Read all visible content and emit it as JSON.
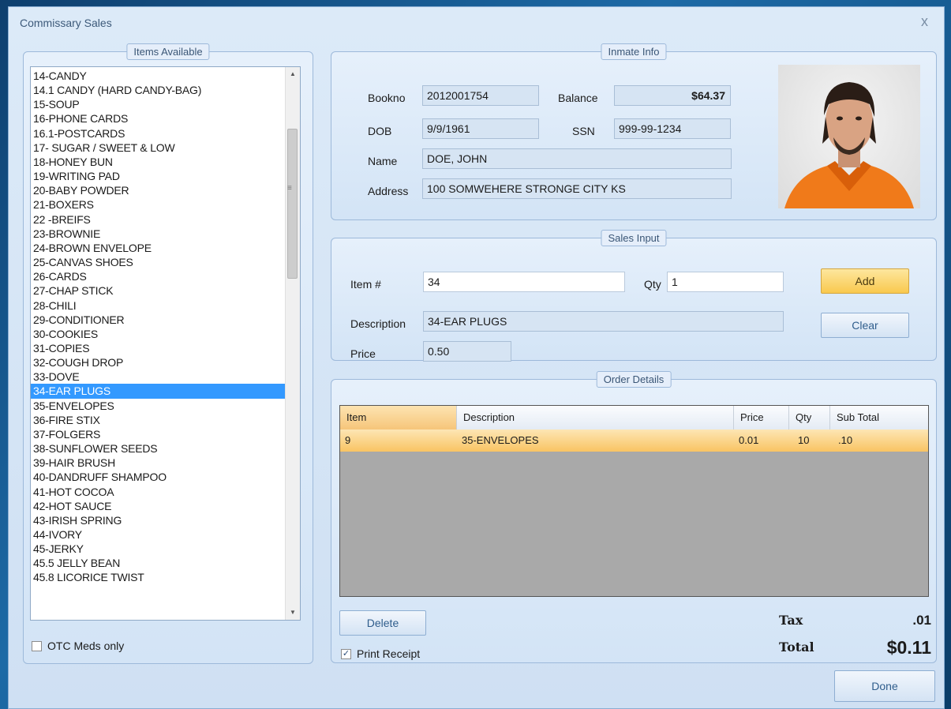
{
  "window": {
    "title": "Commissary Sales",
    "close_glyph": "x"
  },
  "items_panel": {
    "legend": "Items Available",
    "items": [
      "14-CANDY",
      "14.1 CANDY (HARD CANDY-BAG)",
      "15-SOUP",
      "16-PHONE CARDS",
      "16.1-POSTCARDS",
      "17- SUGAR / SWEET & LOW",
      "18-HONEY BUN",
      "19-WRITING PAD",
      "20-BABY POWDER",
      "21-BOXERS",
      "22 -BREIFS",
      "23-BROWNIE",
      "24-BROWN ENVELOPE",
      "25-CANVAS SHOES",
      "26-CARDS",
      "27-CHAP STICK",
      "28-CHILI",
      "29-CONDITIONER",
      "30-COOKIES",
      "31-COPIES",
      "32-COUGH DROP",
      "33-DOVE",
      "34-EAR PLUGS",
      "35-ENVELOPES",
      "36-FIRE STIX",
      "37-FOLGERS",
      "38-SUNFLOWER SEEDS",
      "39-HAIR BRUSH",
      "40-DANDRUFF SHAMPOO",
      "41-HOT COCOA",
      "42-HOT SAUCE",
      "43-IRISH SPRING",
      "44-IVORY",
      "45-JERKY",
      "45.5 JELLY BEAN",
      "45.8 LICORICE TWIST"
    ],
    "selected_index": 22,
    "otc_label": "OTC Meds only",
    "otc_checked": false
  },
  "inmate": {
    "legend": "Inmate Info",
    "bookno_label": "Bookno",
    "bookno": "2012001754",
    "balance_label": "Balance",
    "balance": "$64.37",
    "dob_label": "DOB",
    "dob": "9/9/1961",
    "ssn_label": "SSN",
    "ssn": "999-99-1234",
    "name_label": "Name",
    "name": "DOE, JOHN",
    "address_label": "Address",
    "address": "100 SOMWEHERE STRONGE CITY KS"
  },
  "sales": {
    "legend": "Sales Input",
    "item_label": "Item #",
    "item_value": "34",
    "qty_label": "Qty",
    "qty_value": "1",
    "desc_label": "Description",
    "desc_value": "34-EAR PLUGS",
    "price_label": "Price",
    "price_value": "0.50",
    "add_label": "Add",
    "clear_label": "Clear"
  },
  "order": {
    "legend": "Order Details",
    "columns": [
      "Item",
      "Description",
      "Price",
      "Qty",
      "Sub Total"
    ],
    "rows": [
      {
        "item": "9",
        "description": "35-ENVELOPES",
        "price": "0.01",
        "qty": "10",
        "subtotal": ".10"
      }
    ],
    "delete_label": "Delete",
    "print_label": "Print Receipt",
    "print_checked": true,
    "tax_label": "Tax",
    "tax_value": ".01",
    "total_label": "Total",
    "total_value": "$0.11"
  },
  "done_label": "Done",
  "colors": {
    "selection": "#3399ff",
    "accent_button": "#f9c94e",
    "row_highlight": "#f9c463"
  }
}
